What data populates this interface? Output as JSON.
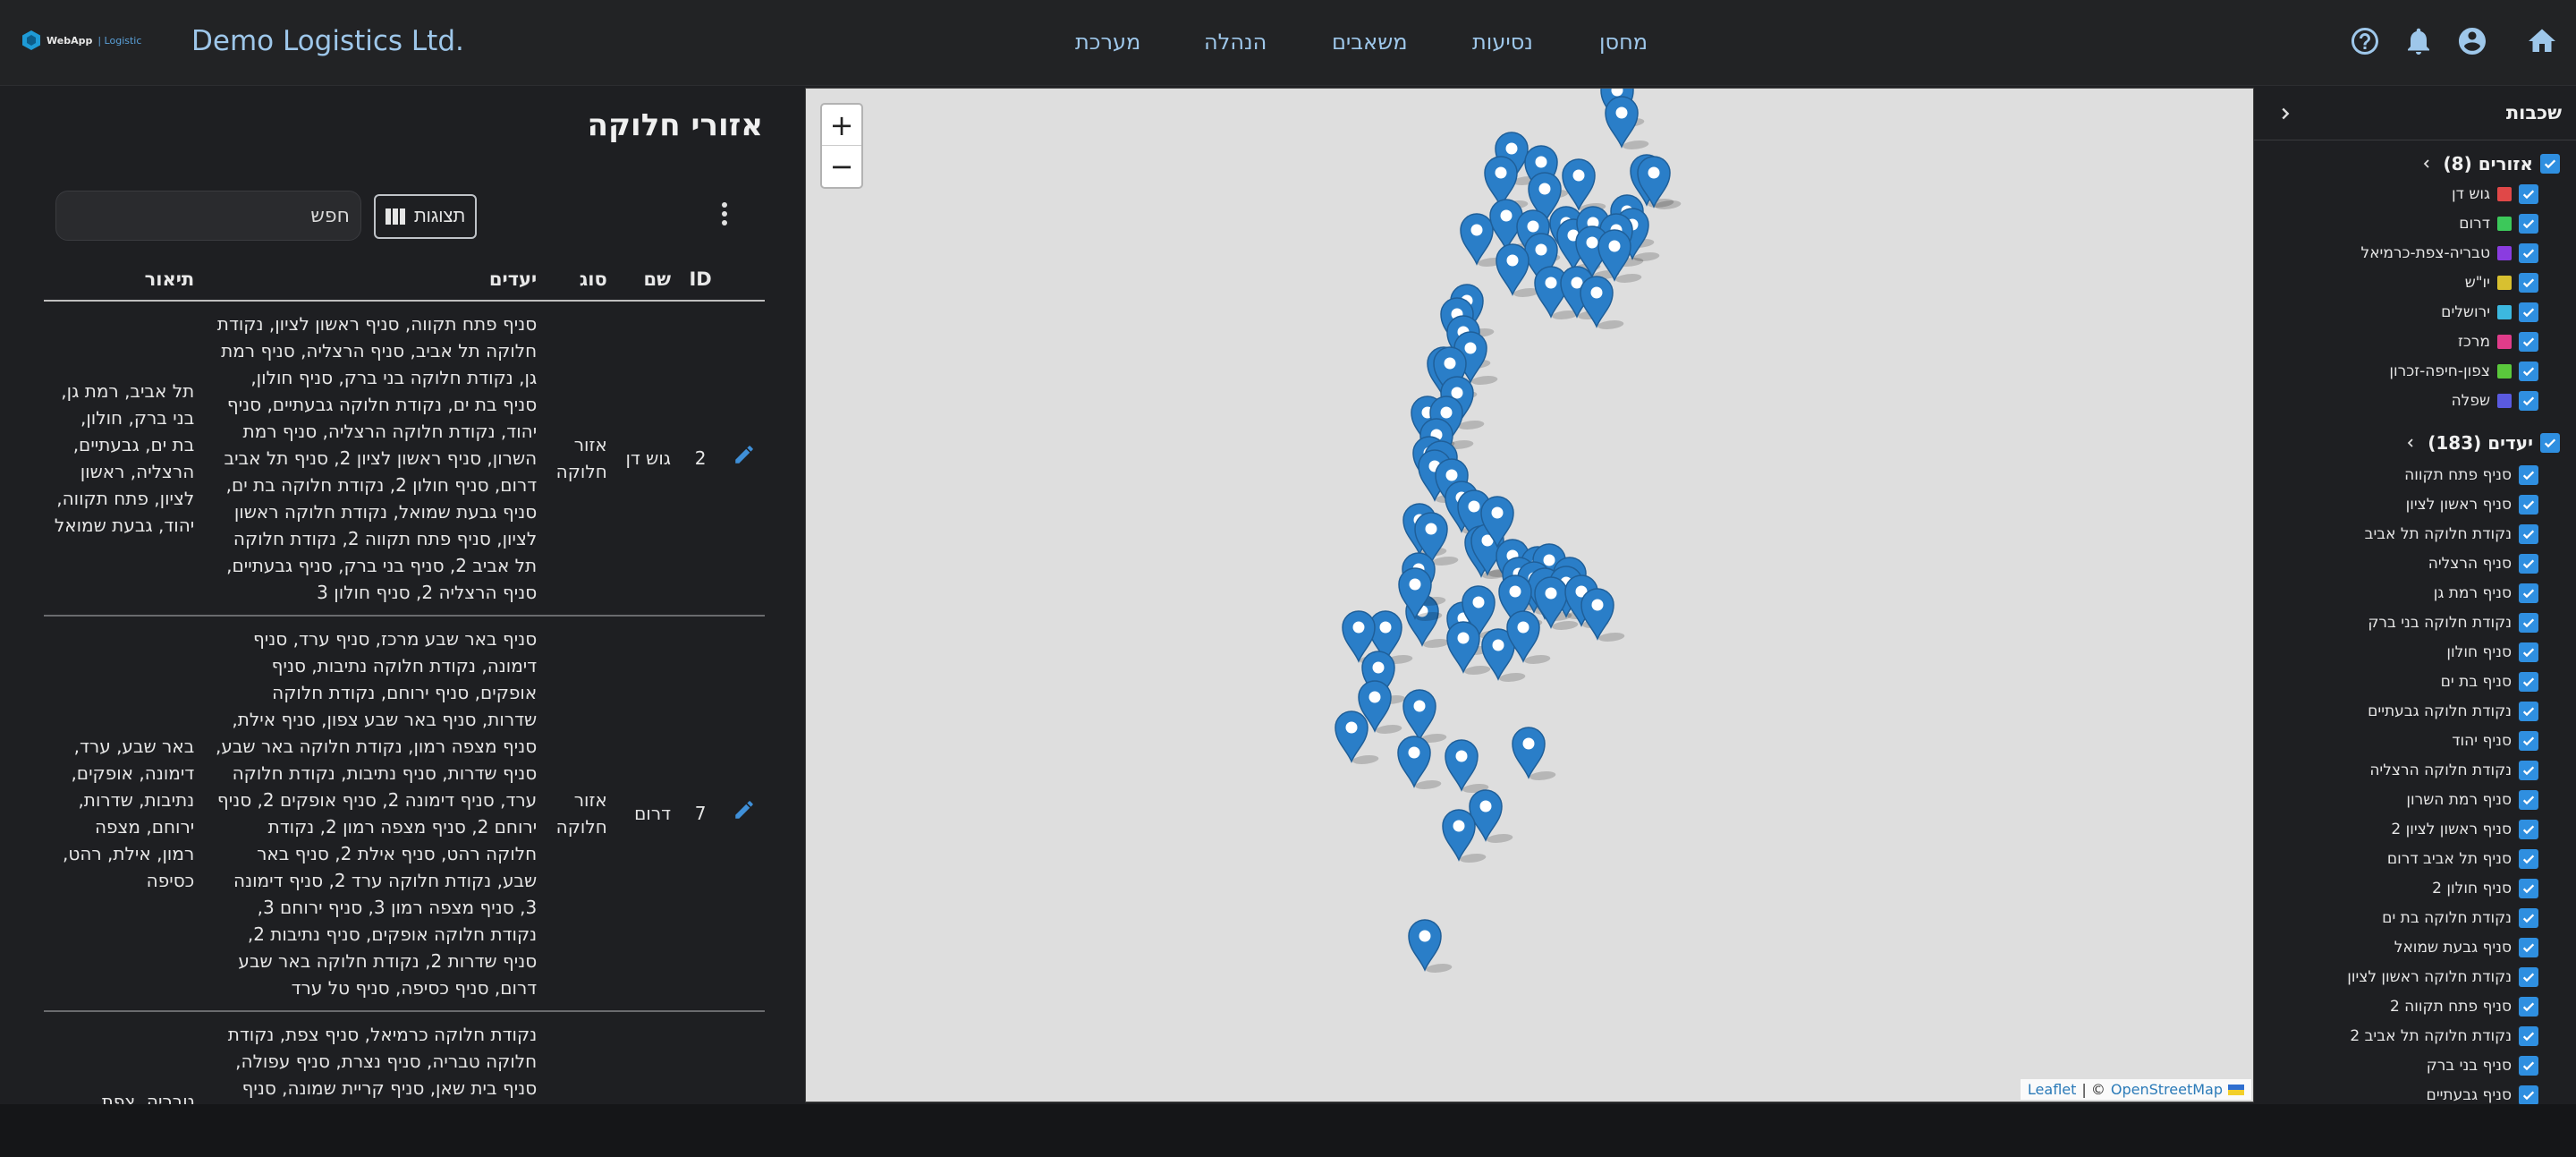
{
  "header": {
    "logo_text": "WebApp",
    "logo_sub": "Logistic",
    "company": "Demo Logistics Ltd.",
    "nav": [
      "מחסן",
      "נסיעות",
      "משאבים",
      "הנהלה",
      "מערכת"
    ],
    "icons": [
      "home-icon",
      "account-icon",
      "bell-icon",
      "help-icon"
    ]
  },
  "page": {
    "title": "אזורי חלוקה",
    "views_label": "תצוגות",
    "search_placeholder": "חפש",
    "columns": {
      "id": "ID",
      "name": "שם",
      "type": "סוג",
      "destinations": "יעדים",
      "description": "תיאור"
    },
    "rows": [
      {
        "id": "2",
        "name": "גוש דן",
        "type": "אזור חלוקה",
        "destinations": "סניף פתח תקווה, סניף ראשון לציון, נקודת חלוקה תל אביב, סניף הרצליה, סניף רמת גן, נקודת חלוקה בני ברק, סניף חולון, סניף בת ים, נקודת חלוקה גבעתיים, סניף יהוד, נקודת חלוקה הרצליה, סניף רמת השרון, סניף ראשון לציון 2, סניף תל אביב דרום, סניף חולון 2, נקודת חלוקה בת ים, סניף גבעת שמואל, נקודת חלוקה ראשון לציון, סניף פתח תקווה 2, נקודת חלוקה תל אביב 2, סניף בני ברק, סניף גבעתיים, סניף הרצליה 2, סניף חולון 3",
        "description": "תל אביב, רמת גן, בני ברק, חולון, בת ים, גבעתיים, הרצליה, ראשון לציון, פתח תקווה, יהוד, גבעת שמואל"
      },
      {
        "id": "7",
        "name": "דרום",
        "type": "אזור חלוקה",
        "destinations": "סניף באר שבע מרכז, סניף ערד, סניף דימונה, נקודת חלוקה נתיבות, סניף אופקים, סניף ירוחם, נקודת חלוקה שדרות, סניף באר שבע צפון, סניף אילת, סניף מצפה רמון, נקודת חלוקה באר שבע, סניף שדרות, סניף נתיבות, נקודת חלוקה ערד, סניף דימונה 2, סניף אופקים 2, סניף ירוחם 2, סניף מצפה רמון 2, נקודת חלוקה רהט, סניף אילת 2, סניף באר שבע, נקודת חלוקה ערד 2, סניף דימונה 3, סניף מצפה רמון 3, סניף ירוחם 3, נקודת חלוקה אופקים, סניף נתיבות 2, סניף שדרות 2, נקודת חלוקה באר שבע דרום, סניף כסיפה, סניף טל ערד",
        "description": "באר שבע, ערד, דימונה, אופקים, נתיבות, שדרות, ירוחם, מצפה רמון, אילת, רהט, כסיפה"
      },
      {
        "id": "",
        "name": "",
        "type": "",
        "destinations": "נקודת חלוקה כרמיאל, סניף צפת, נקודת חלוקה טבריה, סניף נצרת, סניף עפולה, סניף בית שאן, סניף קריית שמונה, סניף כרמיאל מרכז, נקודת חלוקה צפת, סניף טבריה, סניף קריית שמונה 2, סניף נצרת עילית, סניף מגדל",
        "description": "טבריה, צפת,"
      }
    ]
  },
  "map": {
    "zoom_in": "+",
    "zoom_out": "−",
    "attr_leaflet": "Leaflet",
    "attr_sep": "| ©",
    "attr_osm": "OpenStreetMap"
  },
  "layers": {
    "title": "שכבות",
    "areas_group": "אזורים (8)",
    "areas": [
      {
        "label": "גוש דן",
        "color": "#e04848"
      },
      {
        "label": "דרום",
        "color": "#3cc85a"
      },
      {
        "label": "טבריה-צפת-כרמיאל",
        "color": "#8a3ce0"
      },
      {
        "label": "יו\"ש",
        "color": "#d8c030"
      },
      {
        "label": "ירושלים",
        "color": "#3cb8e0"
      },
      {
        "label": "מרכז",
        "color": "#e03c8a"
      },
      {
        "label": "צפון-חיפה-זכרון",
        "color": "#5ac83c"
      },
      {
        "label": "שפלה",
        "color": "#5a5ae0"
      }
    ],
    "dest_group": "יעדים (183)",
    "destinations": [
      "סניף פתח תקווה",
      "סניף ראשון לציון",
      "נקודת חלוקה תל אביב",
      "סניף הרצליה",
      "סניף רמת גן",
      "נקודת חלוקה בני ברק",
      "סניף חולון",
      "סניף בת ים",
      "נקודת חלוקה גבעתיים",
      "סניף יהוד",
      "נקודת חלוקה הרצליה",
      "סניף רמת השרון",
      "סניף ראשון לציון 2",
      "סניף תל אביב דרום",
      "סניף חולון 2",
      "נקודת חלוקה בת ים",
      "סניף גבעת שמואל",
      "נקודת חלוקה ראשון לציון",
      "סניף פתח תקווה 2",
      "נקודת חלוקה תל אביב 2",
      "סניף בני ברק",
      "סניף גבעתיים"
    ]
  }
}
